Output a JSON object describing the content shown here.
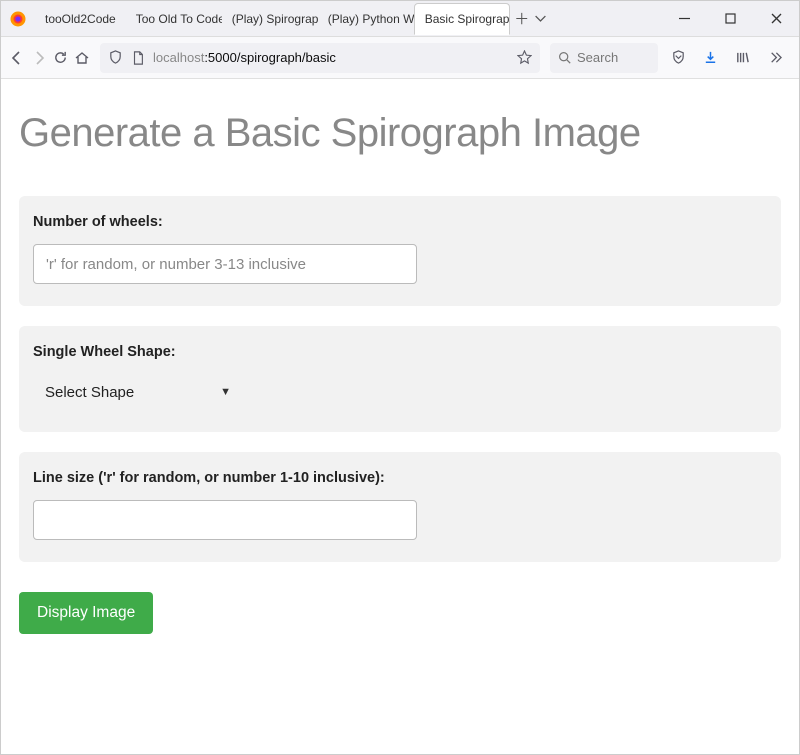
{
  "browser": {
    "tabs": [
      {
        "label": "tooOld2Code"
      },
      {
        "label": "Too Old To Code"
      },
      {
        "label": "(Play) Spirograph"
      },
      {
        "label": "(Play) Python Web"
      },
      {
        "label": "Basic Spirograph",
        "active": true
      }
    ],
    "url_host": "localhost",
    "url_port": ":5000",
    "url_path": "/spirograph/basic",
    "search_placeholder": "Search"
  },
  "page": {
    "title": "Generate a Basic Spirograph Image",
    "fields": {
      "wheels": {
        "label": "Number of wheels:",
        "placeholder": "'r' for random, or number 3-13 inclusive",
        "value": ""
      },
      "shape": {
        "label": "Single Wheel Shape:",
        "selected": "Select Shape"
      },
      "line": {
        "label": "Line size ('r' for random, or number 1-10 inclusive):",
        "value": ""
      }
    },
    "submit_label": "Display Image"
  }
}
